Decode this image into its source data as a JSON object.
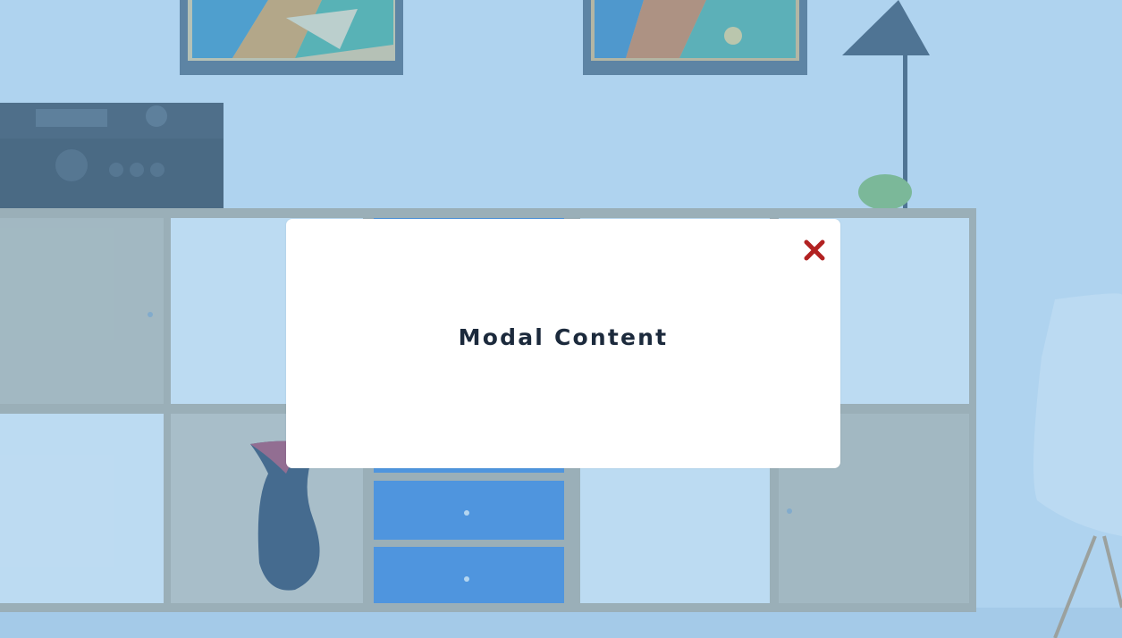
{
  "background": {
    "description_icon": "living-room-cabinet-photo",
    "overlay_color": "#78b9eb"
  },
  "modal": {
    "title": "Modal Content",
    "close_icon": "close-icon",
    "close_color": "#b22222"
  }
}
